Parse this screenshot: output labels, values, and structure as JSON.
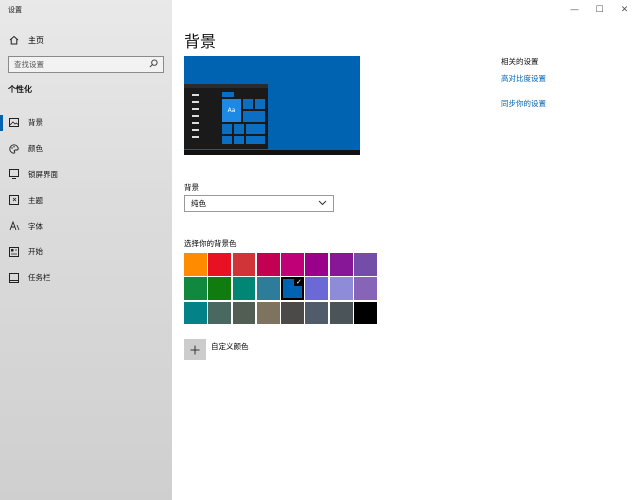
{
  "window": {
    "title": "设置",
    "controls": [
      "—",
      "☐",
      "✕"
    ]
  },
  "sidebar": {
    "home_label": "主页",
    "search_placeholder": "查找设置",
    "section_title": "个性化",
    "items": [
      {
        "label": "背景",
        "icon": "picture-icon",
        "active": true
      },
      {
        "label": "颜色",
        "icon": "palette-icon",
        "active": false
      },
      {
        "label": "锁屏界面",
        "icon": "lock-screen-icon",
        "active": false
      },
      {
        "label": "主题",
        "icon": "theme-icon",
        "active": false
      },
      {
        "label": "字体",
        "icon": "font-icon",
        "active": false
      },
      {
        "label": "开始",
        "icon": "start-icon",
        "active": false
      },
      {
        "label": "任务栏",
        "icon": "taskbar-icon",
        "active": false
      }
    ]
  },
  "main": {
    "title": "背景",
    "preview_tile_text": "Aa",
    "background_label": "背景",
    "background_value": "纯色",
    "choose_color_label": "选择你的背景色",
    "swatches": [
      "#ff8c00",
      "#e81123",
      "#d13438",
      "#c30052",
      "#bf0077",
      "#9a0089",
      "#881798",
      "#744da9",
      "#10893e",
      "#107c10",
      "#018574",
      "#2d7d9a",
      "#0063b1",
      "#6b69d6",
      "#8e8cd8",
      "#8764b8",
      "#038387",
      "#486860",
      "#525e54",
      "#7e735f",
      "#4c4a48",
      "#515c6b",
      "#4a5459",
      "#000000"
    ],
    "selected_swatch_index": 12,
    "custom_color_label": "自定义颜色"
  },
  "related": {
    "heading": "相关的设置",
    "links": [
      "高对比度设置",
      "同步你的设置"
    ]
  },
  "colors": {
    "accent": "#0063b1"
  }
}
